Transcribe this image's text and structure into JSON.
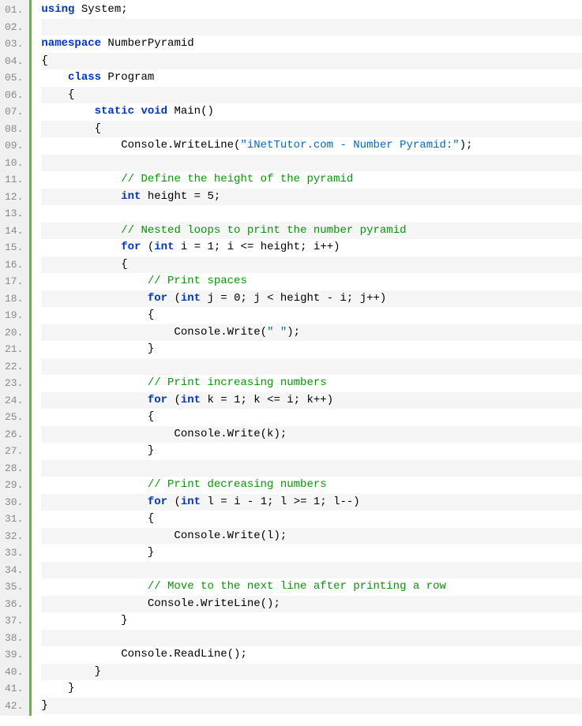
{
  "code": {
    "lines": [
      {
        "num": "01.",
        "segs": [
          {
            "t": "using",
            "c": "kw"
          },
          {
            "t": " System;",
            "c": ""
          }
        ]
      },
      {
        "num": "02.",
        "segs": []
      },
      {
        "num": "03.",
        "segs": [
          {
            "t": "namespace",
            "c": "kw"
          },
          {
            "t": " NumberPyramid",
            "c": ""
          }
        ]
      },
      {
        "num": "04.",
        "segs": [
          {
            "t": "{",
            "c": ""
          }
        ]
      },
      {
        "num": "05.",
        "segs": [
          {
            "t": "    ",
            "c": ""
          },
          {
            "t": "class",
            "c": "kw"
          },
          {
            "t": " Program",
            "c": ""
          }
        ]
      },
      {
        "num": "06.",
        "segs": [
          {
            "t": "    {",
            "c": ""
          }
        ]
      },
      {
        "num": "07.",
        "segs": [
          {
            "t": "        ",
            "c": ""
          },
          {
            "t": "static",
            "c": "kw"
          },
          {
            "t": " ",
            "c": ""
          },
          {
            "t": "void",
            "c": "kw"
          },
          {
            "t": " Main()",
            "c": ""
          }
        ]
      },
      {
        "num": "08.",
        "segs": [
          {
            "t": "        {",
            "c": ""
          }
        ]
      },
      {
        "num": "09.",
        "segs": [
          {
            "t": "            Console.WriteLine(",
            "c": ""
          },
          {
            "t": "\"iNetTutor.com - Number Pyramid:\"",
            "c": "str"
          },
          {
            "t": ");",
            "c": ""
          }
        ]
      },
      {
        "num": "10.",
        "segs": []
      },
      {
        "num": "11.",
        "segs": [
          {
            "t": "            ",
            "c": ""
          },
          {
            "t": "// Define the height of the pyramid",
            "c": "cmt"
          }
        ]
      },
      {
        "num": "12.",
        "segs": [
          {
            "t": "            ",
            "c": ""
          },
          {
            "t": "int",
            "c": "kw"
          },
          {
            "t": " height = 5;",
            "c": ""
          }
        ]
      },
      {
        "num": "13.",
        "segs": []
      },
      {
        "num": "14.",
        "segs": [
          {
            "t": "            ",
            "c": ""
          },
          {
            "t": "// Nested loops to print the number pyramid",
            "c": "cmt"
          }
        ]
      },
      {
        "num": "15.",
        "segs": [
          {
            "t": "            ",
            "c": ""
          },
          {
            "t": "for",
            "c": "kw"
          },
          {
            "t": " (",
            "c": ""
          },
          {
            "t": "int",
            "c": "kw"
          },
          {
            "t": " i = 1; i <= height; i++)",
            "c": ""
          }
        ]
      },
      {
        "num": "16.",
        "segs": [
          {
            "t": "            {",
            "c": ""
          }
        ]
      },
      {
        "num": "17.",
        "segs": [
          {
            "t": "                ",
            "c": ""
          },
          {
            "t": "// Print spaces",
            "c": "cmt"
          }
        ]
      },
      {
        "num": "18.",
        "segs": [
          {
            "t": "                ",
            "c": ""
          },
          {
            "t": "for",
            "c": "kw"
          },
          {
            "t": " (",
            "c": ""
          },
          {
            "t": "int",
            "c": "kw"
          },
          {
            "t": " j = 0; j < height - i; j++)",
            "c": ""
          }
        ]
      },
      {
        "num": "19.",
        "segs": [
          {
            "t": "                {",
            "c": ""
          }
        ]
      },
      {
        "num": "20.",
        "segs": [
          {
            "t": "                    Console.Write(",
            "c": ""
          },
          {
            "t": "\" \"",
            "c": "str"
          },
          {
            "t": ");",
            "c": ""
          }
        ]
      },
      {
        "num": "21.",
        "segs": [
          {
            "t": "                }",
            "c": ""
          }
        ]
      },
      {
        "num": "22.",
        "segs": []
      },
      {
        "num": "23.",
        "segs": [
          {
            "t": "                ",
            "c": ""
          },
          {
            "t": "// Print increasing numbers",
            "c": "cmt"
          }
        ]
      },
      {
        "num": "24.",
        "segs": [
          {
            "t": "                ",
            "c": ""
          },
          {
            "t": "for",
            "c": "kw"
          },
          {
            "t": " (",
            "c": ""
          },
          {
            "t": "int",
            "c": "kw"
          },
          {
            "t": " k = 1; k <= i; k++)",
            "c": ""
          }
        ]
      },
      {
        "num": "25.",
        "segs": [
          {
            "t": "                {",
            "c": ""
          }
        ]
      },
      {
        "num": "26.",
        "segs": [
          {
            "t": "                    Console.Write(k);",
            "c": ""
          }
        ]
      },
      {
        "num": "27.",
        "segs": [
          {
            "t": "                }",
            "c": ""
          }
        ]
      },
      {
        "num": "28.",
        "segs": []
      },
      {
        "num": "29.",
        "segs": [
          {
            "t": "                ",
            "c": ""
          },
          {
            "t": "// Print decreasing numbers",
            "c": "cmt"
          }
        ]
      },
      {
        "num": "30.",
        "segs": [
          {
            "t": "                ",
            "c": ""
          },
          {
            "t": "for",
            "c": "kw"
          },
          {
            "t": " (",
            "c": ""
          },
          {
            "t": "int",
            "c": "kw"
          },
          {
            "t": " l = i - 1; l >= 1; l--)",
            "c": ""
          }
        ]
      },
      {
        "num": "31.",
        "segs": [
          {
            "t": "                {",
            "c": ""
          }
        ]
      },
      {
        "num": "32.",
        "segs": [
          {
            "t": "                    Console.Write(l);",
            "c": ""
          }
        ]
      },
      {
        "num": "33.",
        "segs": [
          {
            "t": "                }",
            "c": ""
          }
        ]
      },
      {
        "num": "34.",
        "segs": []
      },
      {
        "num": "35.",
        "segs": [
          {
            "t": "                ",
            "c": ""
          },
          {
            "t": "// Move to the next line after printing a row",
            "c": "cmt"
          }
        ]
      },
      {
        "num": "36.",
        "segs": [
          {
            "t": "                Console.WriteLine();",
            "c": ""
          }
        ]
      },
      {
        "num": "37.",
        "segs": [
          {
            "t": "            }",
            "c": ""
          }
        ]
      },
      {
        "num": "38.",
        "segs": []
      },
      {
        "num": "39.",
        "segs": [
          {
            "t": "            Console.ReadLine();",
            "c": ""
          }
        ]
      },
      {
        "num": "40.",
        "segs": [
          {
            "t": "        }",
            "c": ""
          }
        ]
      },
      {
        "num": "41.",
        "segs": [
          {
            "t": "    }",
            "c": ""
          }
        ]
      },
      {
        "num": "42.",
        "segs": [
          {
            "t": "}",
            "c": ""
          }
        ]
      }
    ]
  }
}
